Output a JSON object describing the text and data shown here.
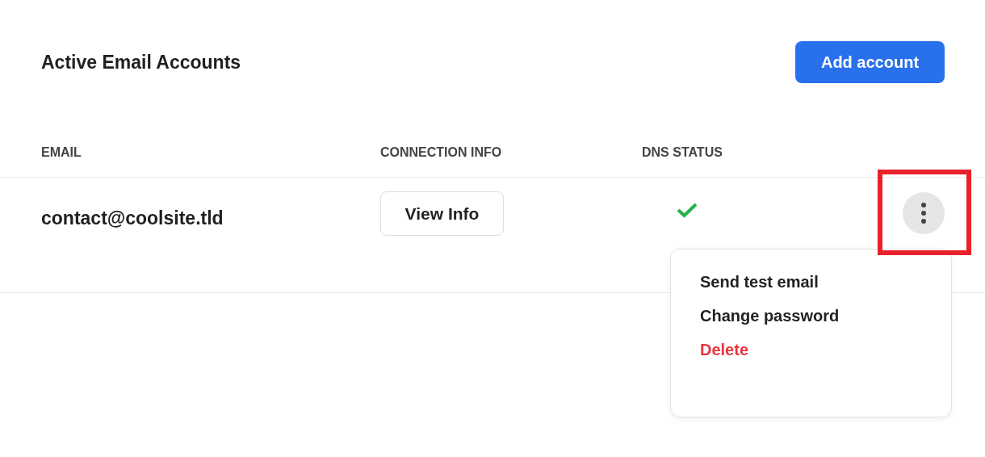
{
  "header": {
    "title": "Active Email Accounts",
    "add_button": "Add account"
  },
  "table": {
    "columns": [
      "EMAIL",
      "CONNECTION INFO",
      "DNS STATUS"
    ],
    "rows": [
      {
        "email": "contact@coolsite.tld",
        "info_button": "View Info",
        "dns_ok": true,
        "actions_highlighted": true,
        "menu_open": true
      }
    ]
  },
  "menu": {
    "items": [
      {
        "label": "Send test email",
        "kind": "normal"
      },
      {
        "label": "Change password",
        "kind": "normal"
      },
      {
        "label": "Delete",
        "kind": "danger"
      }
    ]
  }
}
